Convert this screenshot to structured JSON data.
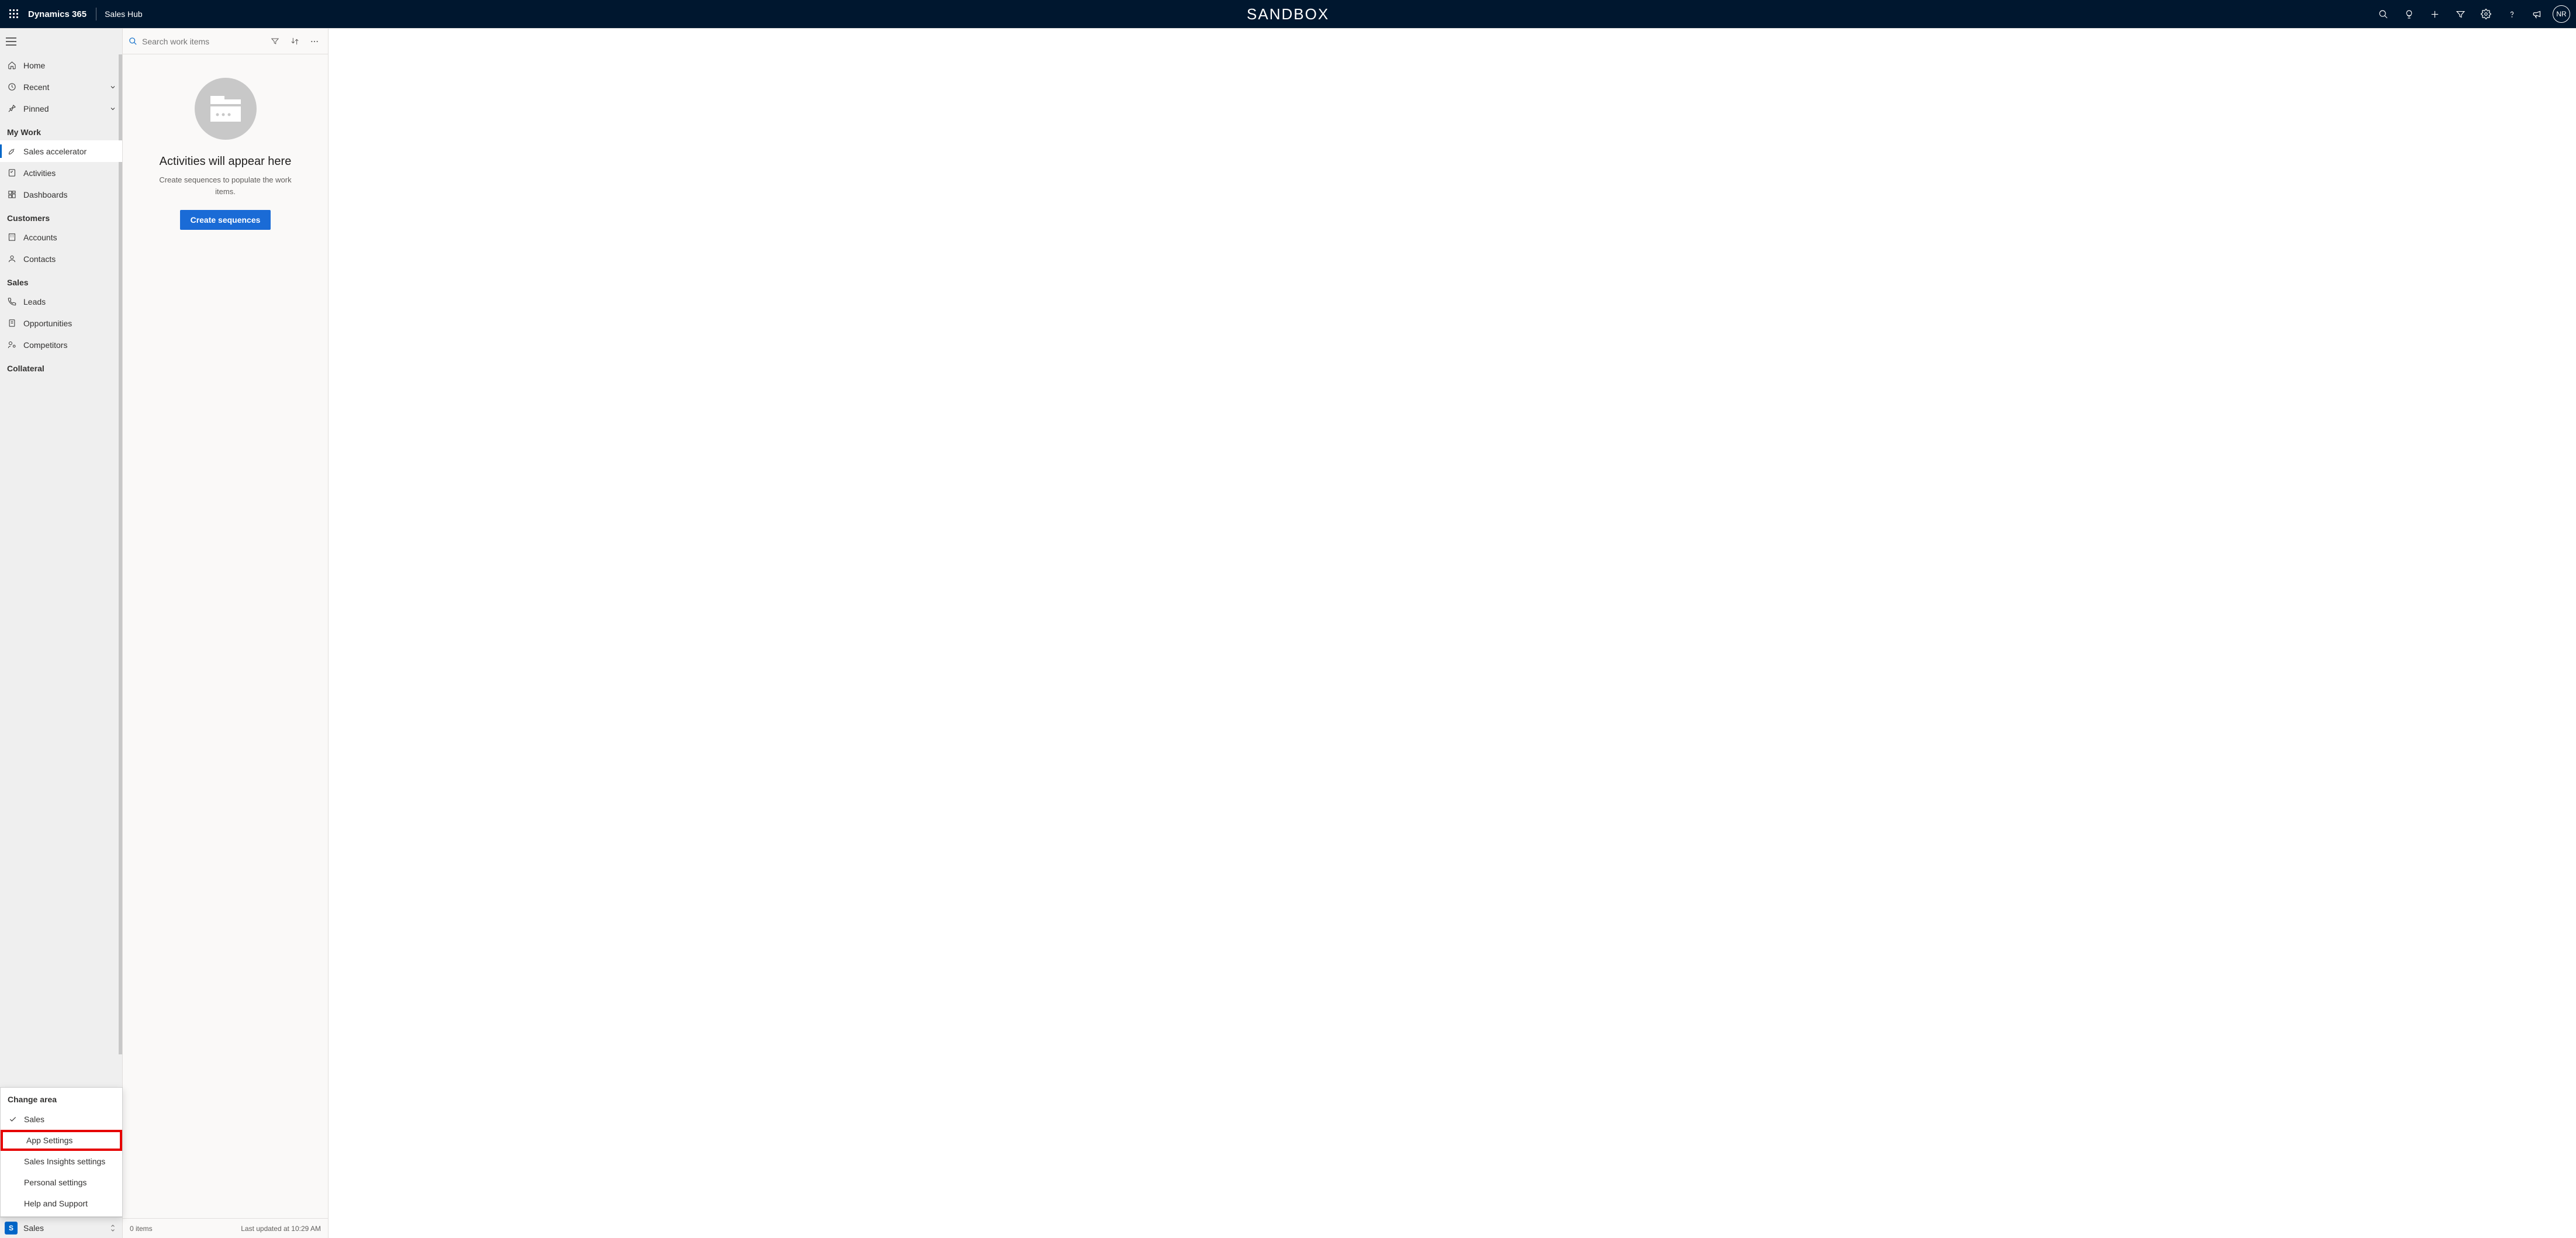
{
  "topbar": {
    "brand": "Dynamics 365",
    "appname": "Sales Hub",
    "environment": "SANDBOX",
    "avatar_initials": "NR"
  },
  "sidebar": {
    "top": {
      "home": "Home",
      "recent": "Recent",
      "pinned": "Pinned"
    },
    "groups": [
      {
        "title": "My Work",
        "items": [
          {
            "label": "Sales accelerator",
            "icon": "rocket-icon",
            "active": true
          },
          {
            "label": "Activities",
            "icon": "checklist-icon"
          },
          {
            "label": "Dashboards",
            "icon": "dashboard-icon"
          }
        ]
      },
      {
        "title": "Customers",
        "items": [
          {
            "label": "Accounts",
            "icon": "building-icon"
          },
          {
            "label": "Contacts",
            "icon": "person-icon"
          }
        ]
      },
      {
        "title": "Sales",
        "items": [
          {
            "label": "Leads",
            "icon": "phone-icon"
          },
          {
            "label": "Opportunities",
            "icon": "opportunity-icon"
          },
          {
            "label": "Competitors",
            "icon": "competitor-icon"
          }
        ]
      },
      {
        "title": "Collateral",
        "items": []
      }
    ]
  },
  "area_popup": {
    "header": "Change area",
    "items": [
      {
        "label": "Sales",
        "checked": true,
        "highlight": false
      },
      {
        "label": "App Settings",
        "checked": false,
        "highlight": true
      },
      {
        "label": "Sales Insights settings",
        "checked": false,
        "highlight": false
      },
      {
        "label": "Personal settings",
        "checked": false,
        "highlight": false
      },
      {
        "label": "Help and Support",
        "checked": false,
        "highlight": false
      }
    ]
  },
  "area_switcher": {
    "badge": "S",
    "label": "Sales"
  },
  "workpanel": {
    "search_placeholder": "Search work items",
    "empty_title": "Activities will appear here",
    "empty_sub": "Create sequences to populate the work items.",
    "create_button": "Create sequences",
    "footer_count": "0 items",
    "footer_updated": "Last updated at 10:29 AM"
  }
}
